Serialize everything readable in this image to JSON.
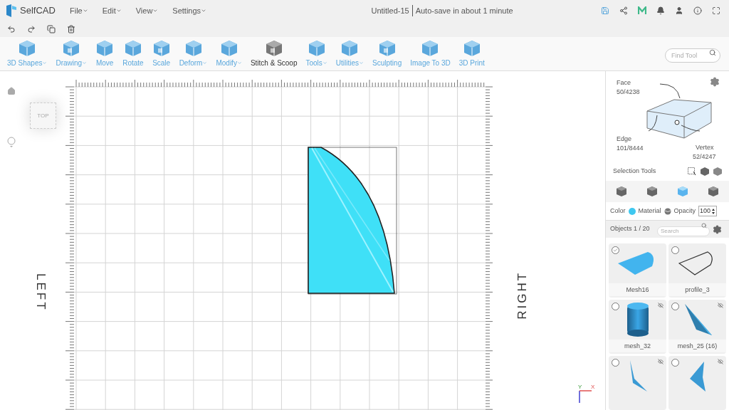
{
  "app": {
    "name": "SelfCAD"
  },
  "menus": [
    {
      "label": "File"
    },
    {
      "label": "Edit"
    },
    {
      "label": "View"
    },
    {
      "label": "Settings"
    }
  ],
  "document": {
    "title": "Untitled-15",
    "autosave": "Auto-save in about 1 minute"
  },
  "tools": [
    {
      "label": "3D Shapes",
      "dropdown": true,
      "selected": false
    },
    {
      "label": "Drawing",
      "dropdown": true,
      "selected": false
    },
    {
      "label": "Move",
      "dropdown": false,
      "selected": false
    },
    {
      "label": "Rotate",
      "dropdown": false,
      "selected": false
    },
    {
      "label": "Scale",
      "dropdown": false,
      "selected": false
    },
    {
      "label": "Deform",
      "dropdown": true,
      "selected": false
    },
    {
      "label": "Modify",
      "dropdown": true,
      "selected": false
    },
    {
      "label": "Stitch & Scoop",
      "dropdown": false,
      "selected": true
    },
    {
      "label": "Tools",
      "dropdown": true,
      "selected": false
    },
    {
      "label": "Utilities",
      "dropdown": true,
      "selected": false
    },
    {
      "label": "Sculpting",
      "dropdown": false,
      "selected": false
    },
    {
      "label": "Image To 3D",
      "dropdown": false,
      "selected": false
    },
    {
      "label": "3D Print",
      "dropdown": false,
      "selected": false
    }
  ],
  "find_tool": {
    "placeholder": "Find Tool"
  },
  "viewport": {
    "view_cube": "TOP",
    "left_label": "LEFT",
    "right_label": "RIGHT",
    "axis_y": "Y",
    "axis_x": "X"
  },
  "selection": {
    "face_label": "Face",
    "face_count": "50/4238",
    "edge_label": "Edge",
    "edge_count": "101/8444",
    "vertex_label": "Vertex",
    "vertex_count": "52/4247",
    "tools_label": "Selection Tools"
  },
  "select_modes": [
    {
      "selected": false
    },
    {
      "selected": false
    },
    {
      "selected": true
    },
    {
      "selected": false
    }
  ],
  "appearance": {
    "color_label": "Color",
    "color": "#3fc8f0",
    "material_label": "Material",
    "opacity_label": "Opacity",
    "opacity": "100"
  },
  "objects_header": {
    "title": "Objects 1 / 20",
    "search_placeholder": "Search"
  },
  "objects": [
    {
      "name": "Mesh16",
      "kind": "flat",
      "checked": true,
      "hidden": false
    },
    {
      "name": "profile_3",
      "kind": "outline",
      "checked": false,
      "hidden": false
    },
    {
      "name": "mesh_32",
      "kind": "cylinder",
      "checked": false,
      "hidden": true
    },
    {
      "name": "mesh_25 (16)",
      "kind": "wedge",
      "checked": false,
      "hidden": true
    },
    {
      "kind": "sliver",
      "checked": false,
      "hidden": true
    },
    {
      "kind": "fin",
      "checked": false,
      "hidden": true
    }
  ]
}
